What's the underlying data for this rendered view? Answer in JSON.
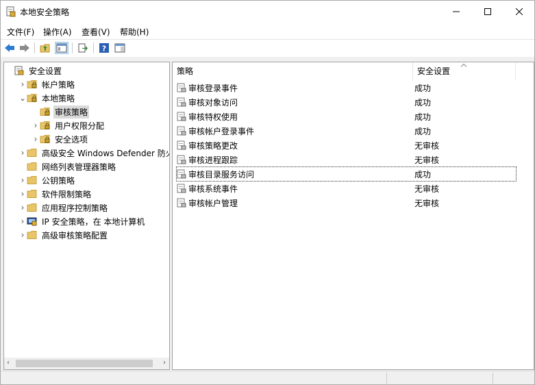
{
  "window": {
    "title": "本地安全策略"
  },
  "menu": [
    "文件(F)",
    "操作(A)",
    "查看(V)",
    "帮助(H)"
  ],
  "tree": [
    {
      "label": "安全设置",
      "level": 0,
      "expander": "none",
      "selected": false,
      "icon": "security-settings-icon"
    },
    {
      "label": "帐户策略",
      "level": 1,
      "expander": "collapsed",
      "selected": false,
      "icon": "folder-lock-icon"
    },
    {
      "label": "本地策略",
      "level": 1,
      "expander": "expanded",
      "selected": false,
      "icon": "folder-open-lock-icon"
    },
    {
      "label": "审核策略",
      "level": 2,
      "expander": "none",
      "selected": true,
      "icon": "folder-lock-icon"
    },
    {
      "label": "用户权限分配",
      "level": 2,
      "expander": "collapsed",
      "selected": false,
      "icon": "folder-lock-icon"
    },
    {
      "label": "安全选项",
      "level": 2,
      "expander": "collapsed",
      "selected": false,
      "icon": "folder-lock-icon"
    },
    {
      "label": "高级安全 Windows Defender 防火墙",
      "level": 1,
      "expander": "collapsed",
      "selected": false,
      "icon": "folder-icon"
    },
    {
      "label": "网络列表管理器策略",
      "level": 1,
      "expander": "none",
      "selected": false,
      "icon": "folder-icon"
    },
    {
      "label": "公钥策略",
      "level": 1,
      "expander": "collapsed",
      "selected": false,
      "icon": "folder-icon"
    },
    {
      "label": "软件限制策略",
      "level": 1,
      "expander": "collapsed",
      "selected": false,
      "icon": "folder-icon"
    },
    {
      "label": "应用程序控制策略",
      "level": 1,
      "expander": "collapsed",
      "selected": false,
      "icon": "folder-icon"
    },
    {
      "label": "IP 安全策略，在 本地计算机",
      "level": 1,
      "expander": "collapsed",
      "selected": false,
      "icon": "ip-security-icon"
    },
    {
      "label": "高级审核策略配置",
      "level": 1,
      "expander": "collapsed",
      "selected": false,
      "icon": "folder-icon"
    }
  ],
  "columns": {
    "policy": "策略",
    "setting": "安全设置"
  },
  "policies": [
    {
      "name": "审核登录事件",
      "value": "成功"
    },
    {
      "name": "审核对象访问",
      "value": "成功"
    },
    {
      "name": "审核特权使用",
      "value": "成功"
    },
    {
      "name": "审核帐户登录事件",
      "value": "成功"
    },
    {
      "name": "审核策略更改",
      "value": "无审核"
    },
    {
      "name": "审核进程跟踪",
      "value": "无审核"
    },
    {
      "name": "审核目录服务访问",
      "value": "成功"
    },
    {
      "name": "审核系统事件",
      "value": "无审核"
    },
    {
      "name": "审核帐户管理",
      "value": "无审核"
    }
  ],
  "focused_policy_index": 6,
  "colors": {
    "folder": "#e8c56a",
    "folder_edge": "#c9a13c",
    "selection": "#d9d9d9",
    "back_arrow": "#2a7bd3"
  }
}
